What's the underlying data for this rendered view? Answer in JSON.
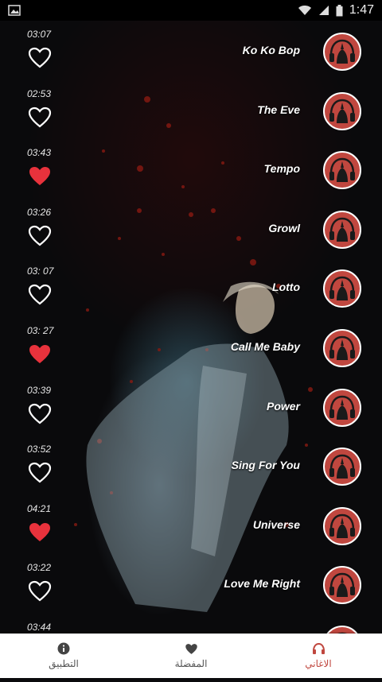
{
  "status_bar": {
    "time": "1:47"
  },
  "songs": [
    {
      "title": "Ko Ko Bop",
      "duration": "03:07",
      "favorite": false
    },
    {
      "title": "The Eve",
      "duration": "02:53",
      "favorite": false
    },
    {
      "title": "Tempo",
      "duration": "03:43",
      "favorite": true
    },
    {
      "title": "Growl",
      "duration": "03:26",
      "favorite": false
    },
    {
      "title": "Lotto",
      "duration": "03: 07",
      "favorite": false
    },
    {
      "title": "Call Me Baby",
      "duration": "03: 27",
      "favorite": true
    },
    {
      "title": "Power",
      "duration": "03:39",
      "favorite": false
    },
    {
      "title": "Sing For You",
      "duration": "03:52",
      "favorite": false
    },
    {
      "title": "Universe",
      "duration": "04:21",
      "favorite": true
    },
    {
      "title": "Love Me Right",
      "duration": "03:22",
      "favorite": false
    },
    {
      "title": "",
      "duration": "03:44",
      "favorite": false
    }
  ],
  "bottom_nav": {
    "items": [
      {
        "label": "التطبيق",
        "icon": "info-icon"
      },
      {
        "label": "المفضلة",
        "icon": "heart-icon"
      },
      {
        "label": "الاغاني",
        "icon": "headphones-icon"
      }
    ],
    "active_index": 2
  },
  "colors": {
    "accent": "#c0473f",
    "heart_filled": "#e8323c",
    "nav_bg": "#ffffff"
  }
}
